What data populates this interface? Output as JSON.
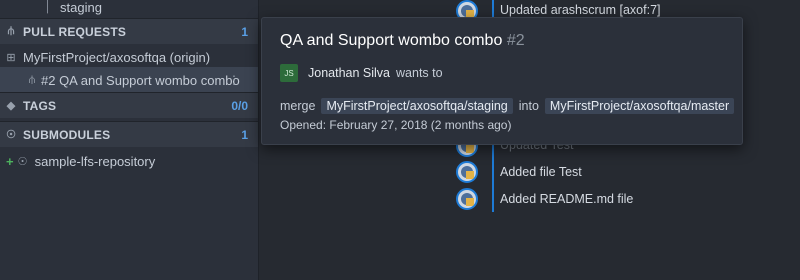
{
  "sidebar": {
    "staging_label": "staging",
    "pull_requests": {
      "label": "PULL REQUESTS",
      "count": "1"
    },
    "pr_repo": "MyFirstProject/axosoftqa (origin)",
    "pr_item": "#2 QA and Support wombo combo",
    "tags": {
      "label": "TAGS",
      "count": "0/0"
    },
    "submodules": {
      "label": "SUBMODULES",
      "count": "1"
    },
    "submodule_item": "sample-lfs-repository"
  },
  "commits": [
    "Updated arashscrum [axof:7]",
    "Updated Test",
    "Added file Test",
    "Added README.md file"
  ],
  "tooltip": {
    "title": "QA and Support wombo combo",
    "number": "#2",
    "author_initials": "JS",
    "author": "Jonathan Silva",
    "wants_to": "wants to",
    "merge_word": "merge",
    "source_branch": "MyFirstProject/axosoftqa/staging",
    "into_word": "into",
    "target_branch": "MyFirstProject/axosoftqa/master",
    "opened": "Opened: February 27, 2018 (2 months ago)"
  },
  "colors": {
    "accent": "#1e7bd6",
    "count": "#5aa0e6",
    "badge_bg": "#2d6b3a"
  }
}
